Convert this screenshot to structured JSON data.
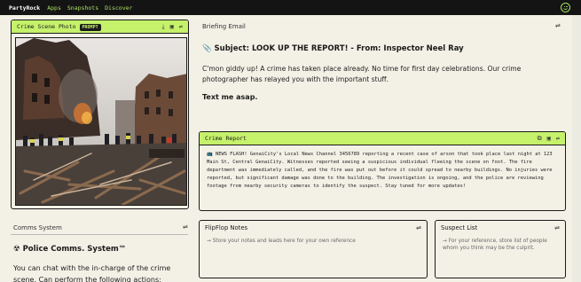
{
  "topbar": {
    "brand": "PartyRock",
    "nav": [
      "Apps",
      "Snapshots",
      "Discover"
    ]
  },
  "crime_photo": {
    "title": "Crime Scene Photo",
    "badge": "PROMPT"
  },
  "briefing": {
    "title": "Briefing Email",
    "subject": "📎 Subject: LOOK UP THE REPORT! - From: Inspector Neel Ray",
    "body": "C'mon giddy up! A crime has taken place already. No time for first day celebrations. Our crime photographer has relayed you with the important stuff.",
    "cta": "Text me asap."
  },
  "crime_report": {
    "title": "Crime Report",
    "text": "📺 NEWS FLASH! GenaiCity's Local News Channel 3456789 reporting a recent case of arson that took place last night at 123 Main St, Central GenaiCity. Witnesses reported seeing a suspicious individual fleeing the scene on foot. The fire department was immediately called, and the fire was put out before it could spread to nearby buildings. No injuries were reported, but significant damage was done to the building. The investigation is ongoing, and the police are reviewing footage from nearby security cameras to identify the suspect. Stay tuned for more updates!"
  },
  "comms": {
    "title": "Comms System",
    "heading": "☢ Police Comms. System™",
    "body": "You can chat with the in-charge of the crime scene. Can perform the following actions:"
  },
  "flipflop": {
    "title": "FlipFlop Notes",
    "placeholder": "→ Store your notes and leads here for your own reference"
  },
  "suspects": {
    "title": "Suspect List",
    "placeholder": "→ For your reference, store list of people whom you think may be the culprit."
  },
  "colors": {
    "accent_green": "#c5f16b",
    "topbar_bg": "#141414",
    "page_bg": "#f3f1e6"
  }
}
